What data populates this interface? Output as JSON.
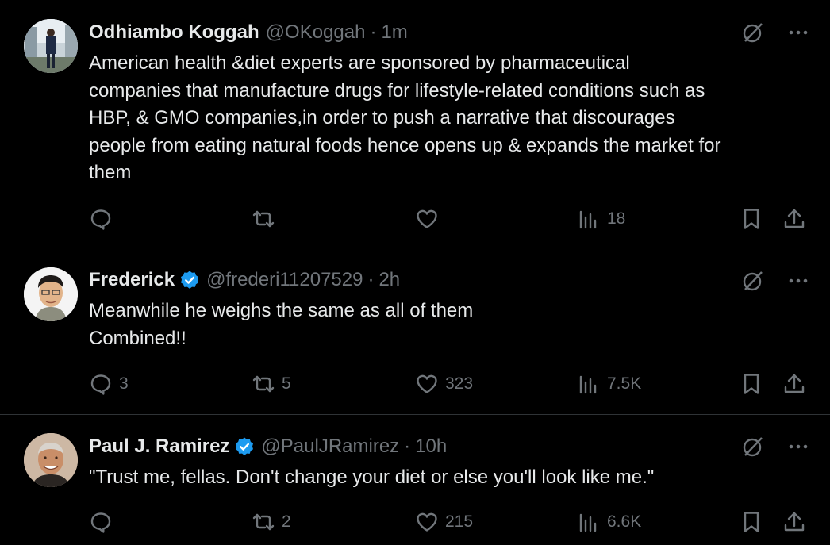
{
  "tweets": [
    {
      "name": "Odhiambo Koggah",
      "handle": "@OKoggah",
      "sep": "·",
      "time": "1m",
      "verified": false,
      "text_lines": [
        "American health &diet experts are sponsored by pharmaceutical",
        "companies that manufacture drugs for lifestyle-related conditions such as",
        "HBP, & GMO companies,in order to push a narrative that discourages",
        "people from eating natural foods hence opens up & expands the market for",
        "them"
      ],
      "replies": "",
      "reposts": "",
      "likes": "",
      "views": "18"
    },
    {
      "name": "Frederick",
      "handle": "@frederi11207529",
      "sep": "·",
      "time": "2h",
      "verified": true,
      "text_lines": [
        "Meanwhile he weighs the same as all of them",
        "Combined!!"
      ],
      "replies": "3",
      "reposts": "5",
      "likes": "323",
      "views": "7.5K"
    },
    {
      "name": "Paul J. Ramirez",
      "handle": "@PaulJRamirez",
      "sep": "·",
      "time": "10h",
      "verified": true,
      "text_lines": [
        "\"Trust me, fellas.  Don't change your diet or else you'll look like me.\""
      ],
      "replies": "",
      "reposts": "2",
      "likes": "215",
      "views": "6.6K"
    }
  ],
  "colors": {
    "background": "#000000",
    "text": "#e7e9ea",
    "muted": "#71767b",
    "verified": "#1d9bf0",
    "divider": "#2f3336"
  },
  "icons": [
    "grok-icon",
    "more-icon",
    "reply-icon",
    "repost-icon",
    "like-icon",
    "views-icon",
    "bookmark-icon",
    "share-icon"
  ]
}
